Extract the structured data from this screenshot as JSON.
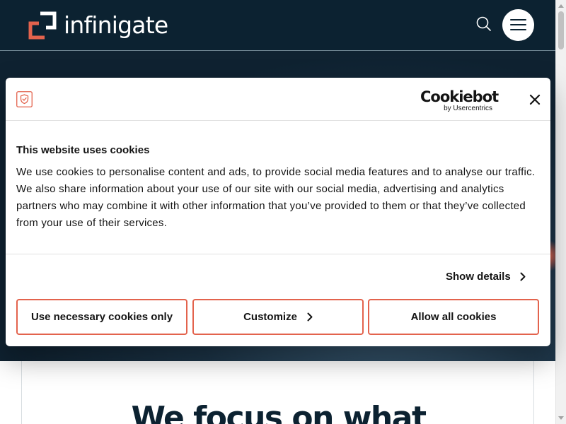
{
  "header": {
    "logo_text": "infinigate",
    "brand_color": "#e3634d",
    "background": "#0c2231"
  },
  "page": {
    "headline": "We focus on what"
  },
  "cookie_dialog": {
    "cookiebot_word": "Cookiebot",
    "cookiebot_sub": "by Usercentrics",
    "title": "This website uses cookies",
    "body": "We use cookies to personalise content and ads, to provide social media features and to analyse our traffic. We also share information about your use of our site with our social media, advertising and analytics partners who may combine it with other information that you’ve provided to them or that they’ve collected from your use of their services.",
    "show_details_label": "Show details",
    "buttons": {
      "necessary": "Use necessary cookies only",
      "customize": "Customize",
      "allow_all": "Allow all cookies"
    },
    "button_border_color": "#e3634d"
  },
  "icons": {
    "search": "search-icon",
    "menu": "hamburger-menu-icon",
    "close": "close-icon",
    "shield": "shield-icon",
    "chevron": "chevron-right-icon"
  }
}
